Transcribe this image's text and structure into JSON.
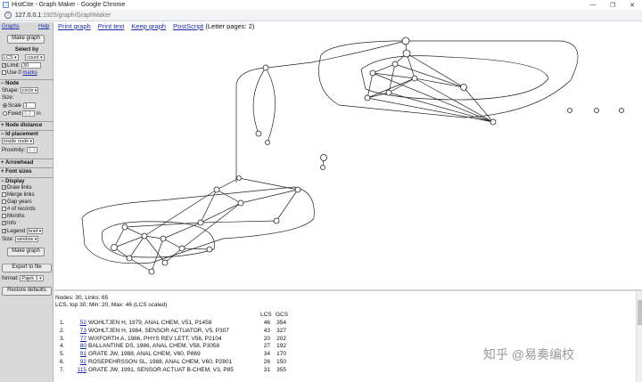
{
  "window": {
    "title": "HistCite - Graph Maker - Google Chrome",
    "url_host": "127.0.0.1",
    "url_path": ":1925/graph/GraphMaker"
  },
  "panel": {
    "graphs_label": "Graphs",
    "help_label": "Help",
    "make_graph_top": "Make graph",
    "select_by_label": "Select by",
    "select_by_value": "LCS",
    "select_mode_value": "count",
    "limit_label": "Limit:",
    "limit_value": "30",
    "use0_label": "Use 0",
    "marks_label": "marks",
    "node_header": "− Node",
    "shape_label": "Shape:",
    "shape_value": "circle",
    "size_label": "Size:",
    "scale_label": "Scale",
    "scale_value": "1",
    "fixed_label": "Fixed",
    "fixed_value": "0.2",
    "fixed_unit": "in",
    "node_distance_header": "+ Node distance",
    "id_placement_header": "− Id placement",
    "id_placement_value": "inside node",
    "proximity_label": "Proximity:",
    "proximity_value": "1.1",
    "arrowhead_header": "+ Arrowhead",
    "font_sizes_header": "+ Font sizes",
    "display_header": "− Display",
    "draw_links_label": "Draw links",
    "merge_links_label": "Merge links",
    "gap_years_label": "Gap years",
    "num_records_label": "# of records",
    "months_label": "Months",
    "info_label": "Info",
    "legend_label": "Legend",
    "legend_value": "brief",
    "size2_label": "Size:",
    "size2_value": "window",
    "make_graph_bottom": "Make graph",
    "export_label": "Export to file",
    "format_label": "format:",
    "format_value": "Pajek 1",
    "restore_label": "Restore defaults"
  },
  "toolbar": {
    "print_graph": "Print graph",
    "print_text": "Print text",
    "keep_graph": "Keep graph",
    "postscript": "PostScript",
    "letter_pages": "(Letter pages: 2)"
  },
  "info": {
    "line1": "Nodes: 30, Links: 65",
    "line2": "LCS, top 30; Min: 20, Max: 46 (LCS scaled)",
    "lcs_header": "LCS",
    "gcs_header": "GCS",
    "records": [
      {
        "num": "1.",
        "id": "52",
        "cite": "WOHLTJEN H, 1979, ANAL CHEM, V51, P1458",
        "lcs": "46",
        "gcs": "354"
      },
      {
        "num": "2.",
        "id": "73",
        "cite": "WOHLTJEN H, 1984, SENSOR ACTUATOR, V5, P307",
        "lcs": "43",
        "gcs": "327"
      },
      {
        "num": "3.",
        "id": "77",
        "cite": "WIXFORTH A, 1986, PHYS REV LETT, V56, P2104",
        "lcs": "20",
        "gcs": "202"
      },
      {
        "num": "4.",
        "id": "80",
        "cite": "BALLANTINE DS, 1986, ANAL CHEM, V58, P3058",
        "lcs": "27",
        "gcs": "192"
      },
      {
        "num": "5.",
        "id": "91",
        "cite": "GRATE JW, 1988, ANAL CHEM, V60, P869",
        "lcs": "34",
        "gcs": "170"
      },
      {
        "num": "6.",
        "id": "92",
        "cite": "ROSEPEHRSSON SL, 1988, ANAL CHEM, V60, P2801",
        "lcs": "26",
        "gcs": "150"
      },
      {
        "num": "7.",
        "id": "115",
        "cite": "GRATE JW, 1991, SENSOR ACTUAT B-CHEM, V3, P85",
        "lcs": "31",
        "gcs": "355"
      }
    ]
  },
  "watermark": "知乎 @易奏编校",
  "colors": {
    "panel_bg": "#d9d9d9",
    "link_blue": "#1a2aa8",
    "graph_stroke": "#222222"
  }
}
